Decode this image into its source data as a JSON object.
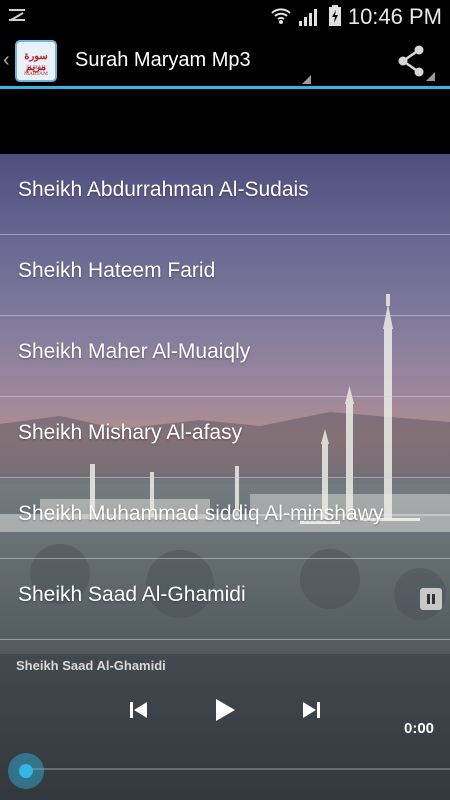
{
  "status_bar": {
    "time": "10:46 PM"
  },
  "action_bar": {
    "title": "Surah Maryam Mp3",
    "logo_text_ar": "سورة مريم",
    "logo_text_en": "SURAH MARYAM"
  },
  "reciters": [
    {
      "label": "Sheikh Abdurrahman Al-Sudais"
    },
    {
      "label": "Sheikh Hateem Farid"
    },
    {
      "label": "Sheikh Maher Al-Muaiqly"
    },
    {
      "label": "Sheikh Mishary Al-afasy"
    },
    {
      "label": "Sheikh Muhammad siddiq Al-minshawy"
    },
    {
      "label": "Sheikh Saad Al-Ghamidi",
      "playing": true
    }
  ],
  "player": {
    "now_playing": "Sheikh Saad Al-Ghamidi",
    "elapsed": "0:00",
    "progress": 0
  },
  "colors": {
    "accent": "#33b5e5",
    "action_bar": "#000000"
  },
  "icons": [
    "notification-icon",
    "wifi-icon",
    "signal-icon",
    "battery-icon",
    "share-icon",
    "pause-icon",
    "previous-icon",
    "play-icon",
    "next-icon"
  ]
}
